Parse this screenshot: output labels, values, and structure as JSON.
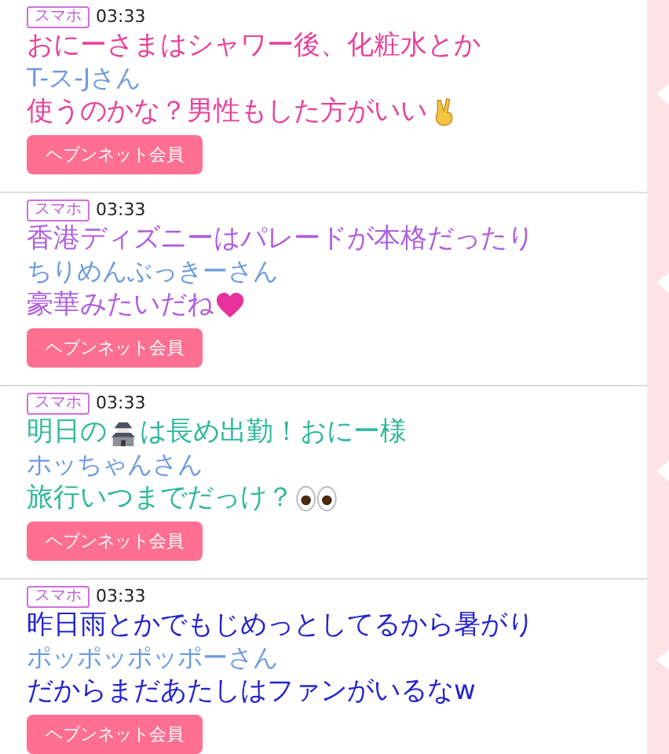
{
  "posts": [
    {
      "tag": "スマホ",
      "time": "03:33",
      "name": "T-ス-Jさん",
      "badge": "ヘブンネット会員",
      "color": "#e8409a",
      "caption": [
        [
          {
            "kind": "text",
            "text": "おにーさまはシャワー後、化粧水とか"
          }
        ],
        [
          {
            "kind": "text",
            "text": "使うのかな？男性もした方がいい"
          },
          {
            "kind": "peace"
          }
        ]
      ]
    },
    {
      "tag": "スマホ",
      "time": "03:33",
      "name": "ちりめんぶっきーさん",
      "badge": "ヘブンネット会員",
      "color": "#b05ee0",
      "caption": [
        [
          {
            "kind": "text",
            "text": "香港ディズニーはパレードが本格だったり"
          }
        ],
        [
          {
            "kind": "text",
            "text": "豪華みたいだね"
          },
          {
            "kind": "heart"
          }
        ]
      ]
    },
    {
      "tag": "スマホ",
      "time": "03:33",
      "name": "ホッちゃんさん",
      "badge": "ヘブンネット会員",
      "color": "#2fb89c",
      "caption": [
        [
          {
            "kind": "text",
            "text": "明日の"
          },
          {
            "kind": "castle"
          },
          {
            "kind": "text",
            "text": "は長め出勤！おにー様"
          }
        ],
        [
          {
            "kind": "text",
            "text": "旅行いつまでだっけ？"
          },
          {
            "kind": "eyes"
          }
        ]
      ]
    },
    {
      "tag": "スマホ",
      "time": "03:33",
      "name": "ポッポッポッポーさん",
      "badge": "ヘブンネット会員",
      "color": "#2424cc",
      "caption": [
        [
          {
            "kind": "text",
            "text": "昨日雨とかでもじめっとしてるから暑がり"
          }
        ],
        [
          {
            "kind": "text",
            "text": "だからまだあたしはファンがいるなw"
          }
        ]
      ]
    }
  ]
}
